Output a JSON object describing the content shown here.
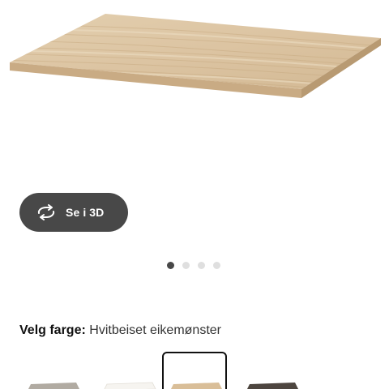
{
  "product": {
    "image_name": "table-top-whitewashed-oak"
  },
  "view3d": {
    "label": "Se i 3D",
    "icon": "rotate-3d-icon"
  },
  "carousel": {
    "count": 4,
    "active_index": 0
  },
  "color": {
    "heading_label": "Velg farge:",
    "selected_value": "Hvitbeiset eikemønster",
    "selected_index": 2,
    "swatch_colors": [
      "#a9a39b",
      "#f4f2ee",
      "#d6bb95",
      "#4a423c"
    ]
  },
  "colors": {
    "button_bg": "#484848",
    "text": "#111111",
    "dot_inactive": "#dfdfdf"
  }
}
